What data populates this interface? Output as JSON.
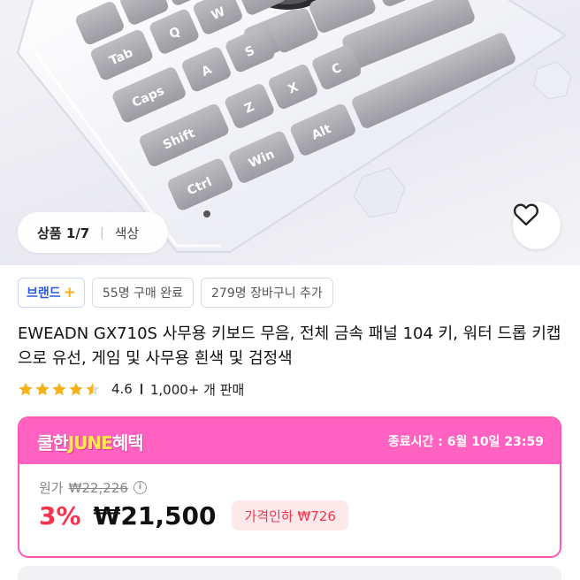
{
  "gallery": {
    "counter": "상품 1/7",
    "option_label": "색상",
    "keycaps": [
      "Tab",
      "Caps",
      "Shift",
      "Ctrl",
      "Win",
      "Alt",
      "Q",
      "A",
      "Z",
      "X",
      "C",
      "S",
      "W"
    ]
  },
  "badges": {
    "brand": "브랜드",
    "purchases": "55명 구매 완료",
    "cart": "279명 장바구니 추가"
  },
  "product": {
    "title": "EWEADN GX710S 사무용 키보드 무음, 전체 금속 패널 104 키, 워터 드롭 키캡으로 유선, 게임 및 사무용 흰색 및 검정색"
  },
  "rating": {
    "stars": 4.5,
    "score": "4.6",
    "sales": "1,000+ 개 판매"
  },
  "promo": {
    "logo_pre": "쿨한",
    "logo_june": "JUNE",
    "logo_post": "혜택",
    "deadline": "종료시간 : 6월 10일 23:59",
    "original_label": "원가",
    "original_price": "₩22,226",
    "discount": "3%",
    "price": "₩21,500",
    "price_cut": "가격인하 ₩726"
  },
  "colors": {
    "promo_pink": "#ff62c0",
    "discount_red": "#f5334f",
    "brand_blue": "#2d5bd8",
    "star": "#f6b21a"
  }
}
